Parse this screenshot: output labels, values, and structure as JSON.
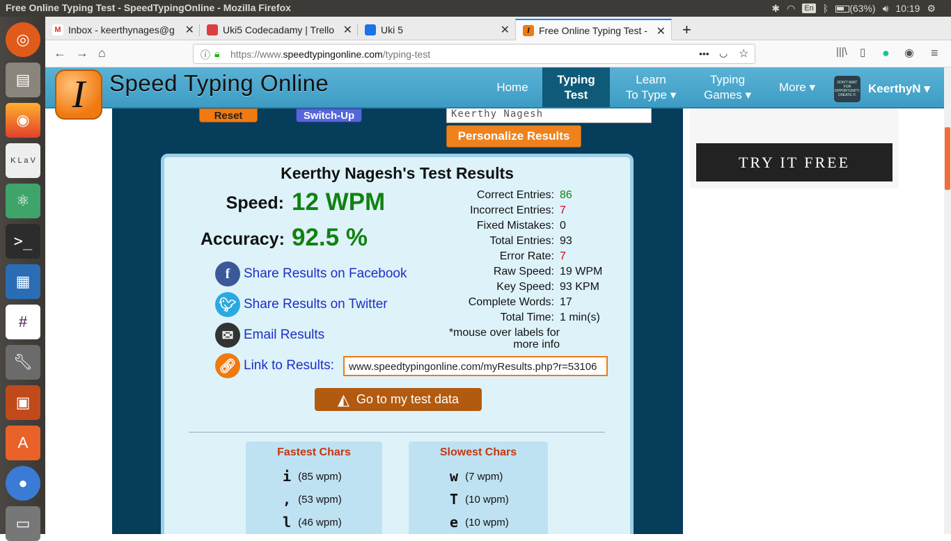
{
  "os": {
    "window_title": "Free Online Typing Test - SpeedTypingOnline - Mozilla Firefox",
    "keyboard_layout": "En",
    "battery": "(63%)",
    "clock": "10:19"
  },
  "browser": {
    "tabs": [
      {
        "label": "Inbox - keerthynages@g",
        "favicon": "M",
        "active": false
      },
      {
        "label": "Uki5 Codecadamy | Trello",
        "favicon": "",
        "active": false
      },
      {
        "label": "Uki 5",
        "favicon": "",
        "active": false
      },
      {
        "label": "Free Online Typing Test -",
        "favicon": "I",
        "active": true
      }
    ],
    "new_tab": "+",
    "url_prefix": "https://www.",
    "url_domain": "speedtypingonline.com",
    "url_path": "/typing-test",
    "page_actions": "•••"
  },
  "site": {
    "brand": "Speed Typing Online",
    "logo_letter": "I",
    "nav": [
      {
        "label": "Home"
      },
      {
        "label_line1": "Typing",
        "label_line2": "Test"
      },
      {
        "label_line1": "Learn",
        "label_line2": "To Type ▾"
      },
      {
        "label_line1": "Typing",
        "label_line2": "Games ▾"
      },
      {
        "label": "More ▾"
      }
    ],
    "user_name": "KeerthyN ▾",
    "avatar_text": "DON'T WAIT FOR OPPORTUNITY. CREATE IT."
  },
  "controls": {
    "reset": "Reset",
    "switch_up": "Switch-Up",
    "name_value": "Keerthy Nagesh",
    "personalize": "Personalize Results"
  },
  "results": {
    "title": "Keerthy Nagesh's Test Results",
    "speed_label": "Speed:",
    "speed_value": "12 WPM",
    "accuracy_label": "Accuracy:",
    "accuracy_value": "92.5 %",
    "stats": [
      {
        "label": "Correct Entries:",
        "value": "86",
        "color": "green"
      },
      {
        "label": "Incorrect Entries:",
        "value": "7",
        "color": "red"
      },
      {
        "label": "Fixed Mistakes:",
        "value": "0",
        "color": ""
      },
      {
        "label": "Total Entries:",
        "value": "93",
        "color": ""
      },
      {
        "label": "Error Rate:",
        "value": "7",
        "color": "red"
      },
      {
        "label": "Raw Speed:",
        "value": "19 WPM",
        "color": ""
      },
      {
        "label": "Key Speed:",
        "value": "93 KPM",
        "color": ""
      },
      {
        "label": "Complete Words:",
        "value": "17",
        "color": ""
      },
      {
        "label": "Total Time:",
        "value": "1 min(s)",
        "color": ""
      }
    ],
    "stats_note": "*mouse over labels for more info",
    "share_facebook": "Share Results on Facebook",
    "share_twitter": "Share Results on Twitter",
    "email": "Email Results",
    "link_label": "Link to Results:",
    "link_value": "www.speedtypingonline.com/myResults.php?r=53106",
    "data_button": "Go to my test data",
    "fastest_title": "Fastest Chars",
    "fastest": [
      {
        "char": "i",
        "speed": "(85 wpm)"
      },
      {
        "char": ",",
        "speed": "(53 wpm)"
      },
      {
        "char": "l",
        "speed": "(46 wpm)"
      }
    ],
    "slowest_title": "Slowest Chars",
    "slowest": [
      {
        "char": "w",
        "speed": "(7 wpm)"
      },
      {
        "char": "T",
        "speed": "(10 wpm)"
      },
      {
        "char": "e",
        "speed": "(10 wpm)"
      }
    ]
  },
  "sidebar": {
    "try_free": "TRY IT FREE"
  }
}
